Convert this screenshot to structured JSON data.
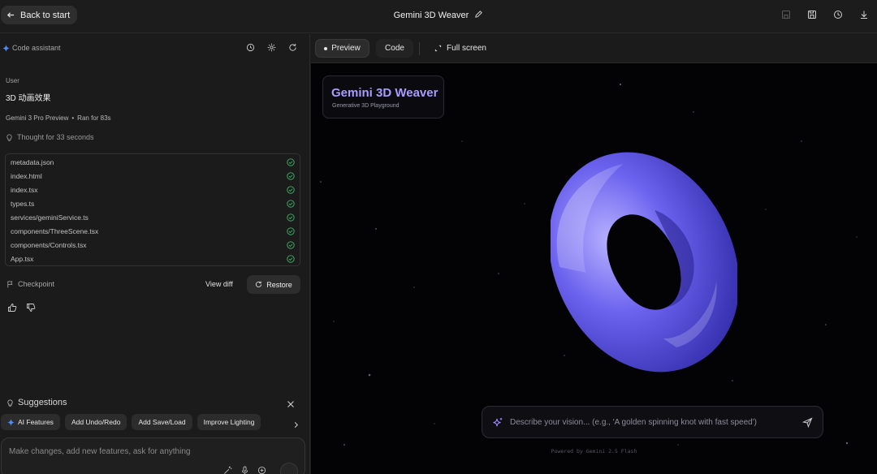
{
  "topbar": {
    "back_label": "Back to start",
    "title": "Gemini 3D Weaver",
    "icons": [
      "save-disabled-icon",
      "save-icon",
      "history-icon",
      "download-icon"
    ]
  },
  "assistant": {
    "label": "Code assistant",
    "header_icons": [
      "history-icon",
      "gear-icon",
      "refresh-icon"
    ],
    "user_label": "User",
    "user_message": "3D 动画效果",
    "model": "Gemini 3 Pro Preview",
    "ran_for": "Ran for 83s",
    "thought": "Thought for 33 seconds",
    "files": [
      {
        "name": "metadata.json",
        "status": "done"
      },
      {
        "name": "index.html",
        "status": "done"
      },
      {
        "name": "index.tsx",
        "status": "done"
      },
      {
        "name": "types.ts",
        "status": "done"
      },
      {
        "name": "services/geminiService.ts",
        "status": "done"
      },
      {
        "name": "components/ThreeScene.tsx",
        "status": "done"
      },
      {
        "name": "components/Controls.tsx",
        "status": "done"
      },
      {
        "name": "App.tsx",
        "status": "done"
      }
    ],
    "checkpoint_label": "Checkpoint",
    "view_diff_label": "View diff",
    "restore_label": "Restore"
  },
  "suggestions": {
    "title": "Suggestions",
    "chips": [
      "AI Features",
      "Add Undo/Redo",
      "Add Save/Load",
      "Improve Lighting"
    ]
  },
  "composer": {
    "placeholder": "Make changes, add new features, ask for anything"
  },
  "tabs": {
    "preview": "Preview",
    "code": "Code",
    "fullscreen": "Full screen"
  },
  "preview": {
    "brand_title": "Gemini 3D Weaver",
    "brand_subtitle": "Generative 3D Playground",
    "vision_placeholder": "Describe your vision... (e.g., 'A golden spinning knot with fast speed')",
    "powered_by": "Powered by Gemini 2.5 Flash"
  },
  "colors": {
    "accent": "#a89cff",
    "torus": "#5b53e0",
    "success": "#3fb56a",
    "background": "#1b1b1b",
    "canvas": "#030306"
  }
}
